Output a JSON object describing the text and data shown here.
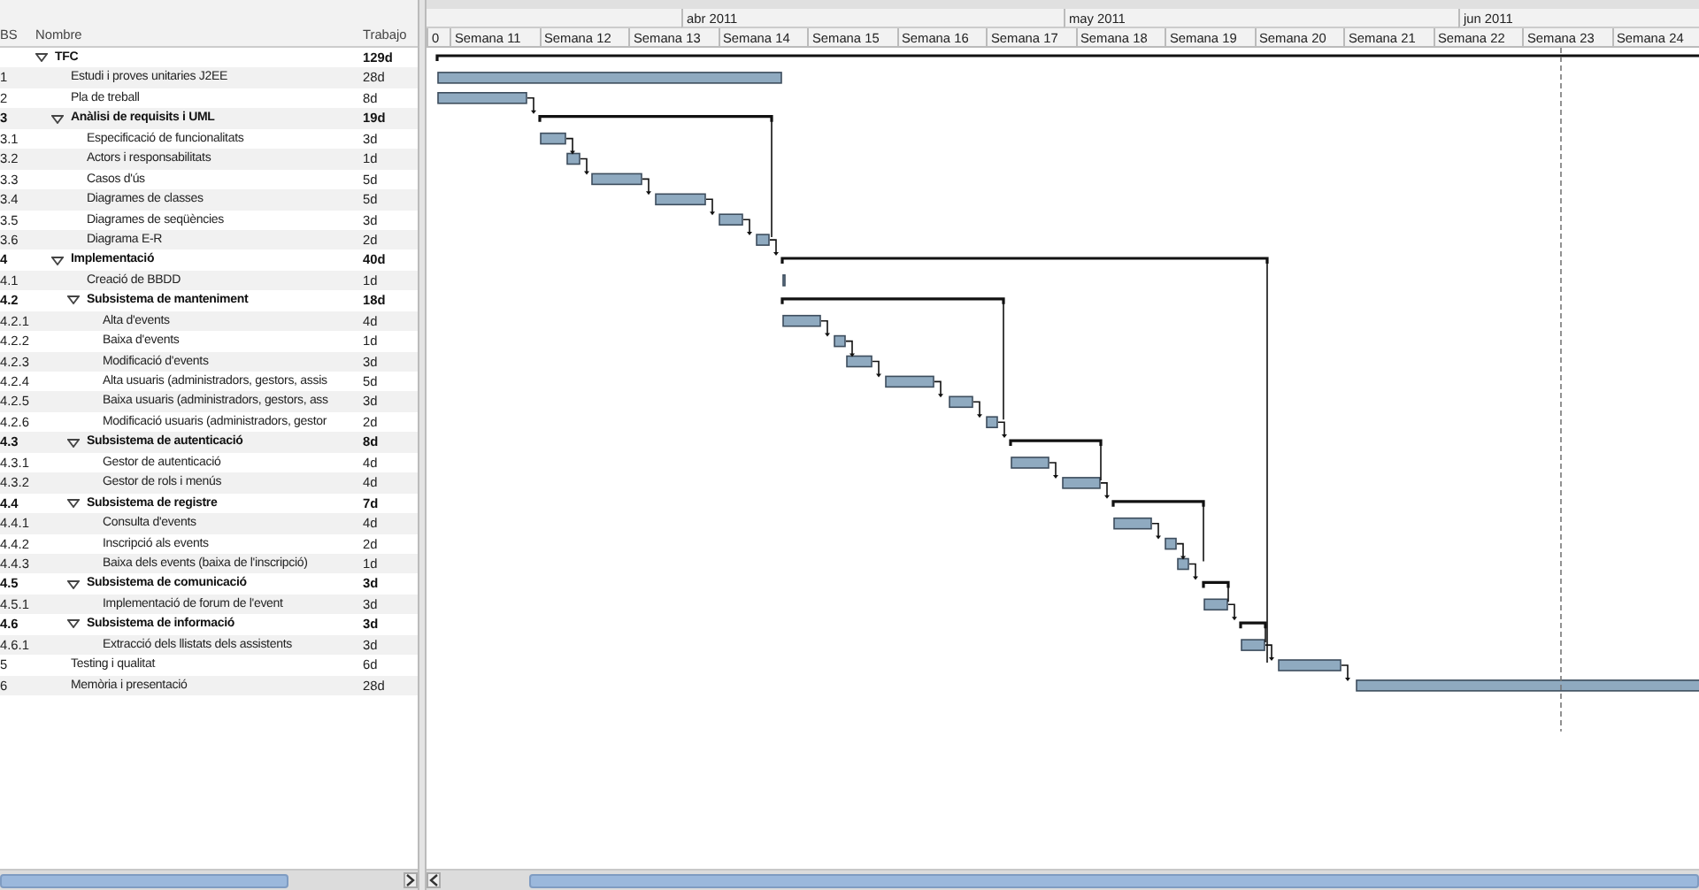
{
  "table": {
    "columns": [
      "BS",
      "Nombre",
      "Trabajo"
    ],
    "tasks": [
      {
        "name": "TFC",
        "work": "129d",
        "expanded": true,
        "children": [
          {
            "wbs": "1",
            "name": "Estudi i proves unitaries J2EE",
            "work": "28d"
          },
          {
            "wbs": "2",
            "name": "Pla de treball",
            "work": "8d"
          },
          {
            "wbs": "3",
            "name": "Anàlisi de requisits i UML",
            "work": "19d",
            "expanded": true,
            "children": [
              {
                "wbs": "3.1",
                "name": "Especificació de funcionalitats",
                "work": "3d"
              },
              {
                "wbs": "3.2",
                "name": "Actors i responsabilitats",
                "work": "1d"
              },
              {
                "wbs": "3.3",
                "name": "Casos d'ús",
                "work": "5d"
              },
              {
                "wbs": "3.4",
                "name": "Diagrames de classes",
                "work": "5d"
              },
              {
                "wbs": "3.5",
                "name": "Diagrames de seqüències",
                "work": "3d"
              },
              {
                "wbs": "3.6",
                "name": "Diagrama E-R",
                "work": "2d"
              }
            ]
          },
          {
            "wbs": "4",
            "name": "Implementació",
            "work": "40d",
            "expanded": true,
            "children": [
              {
                "wbs": "4.1",
                "name": "Creació de BBDD",
                "work": "1d"
              },
              {
                "wbs": "4.2",
                "name": "Subsistema de manteniment",
                "work": "18d",
                "expanded": true,
                "children": [
                  {
                    "wbs": "4.2.1",
                    "name": "Alta d'events",
                    "work": "4d"
                  },
                  {
                    "wbs": "4.2.2",
                    "name": "Baixa d'events",
                    "work": "1d"
                  },
                  {
                    "wbs": "4.2.3",
                    "name": "Modificació d'events",
                    "work": "3d"
                  },
                  {
                    "wbs": "4.2.4",
                    "name": "Alta usuaris (administradors, gestors, assis",
                    "work": "5d"
                  },
                  {
                    "wbs": "4.2.5",
                    "name": "Baixa usuaris (administradors, gestors, ass",
                    "work": "3d"
                  },
                  {
                    "wbs": "4.2.6",
                    "name": "Modificació usuaris (administradors, gestor",
                    "work": "2d"
                  }
                ]
              },
              {
                "wbs": "4.3",
                "name": "Subsistema de autenticació",
                "work": "8d",
                "expanded": true,
                "children": [
                  {
                    "wbs": "4.3.1",
                    "name": "Gestor de autenticació",
                    "work": "4d"
                  },
                  {
                    "wbs": "4.3.2",
                    "name": "Gestor de rols i menús",
                    "work": "4d"
                  }
                ]
              },
              {
                "wbs": "4.4",
                "name": "Subsistema de registre",
                "work": "7d",
                "expanded": true,
                "children": [
                  {
                    "wbs": "4.4.1",
                    "name": "Consulta d'events",
                    "work": "4d"
                  },
                  {
                    "wbs": "4.4.2",
                    "name": "Inscripció als events",
                    "work": "2d"
                  },
                  {
                    "wbs": "4.4.3",
                    "name": "Baixa dels events (baixa de l'inscripció)",
                    "work": "1d"
                  }
                ]
              },
              {
                "wbs": "4.5",
                "name": "Subsistema de comunicació",
                "work": "3d",
                "expanded": true,
                "children": [
                  {
                    "wbs": "4.5.1",
                    "name": "Implementació de forum de l'event",
                    "work": "3d"
                  }
                ]
              },
              {
                "wbs": "4.6",
                "name": "Subsistema de informació",
                "work": "3d",
                "expanded": true,
                "children": [
                  {
                    "wbs": "4.6.1",
                    "name": "Extracció dels llistats dels assistents",
                    "work": "3d"
                  }
                ]
              }
            ]
          },
          {
            "wbs": "5",
            "name": "Testing i qualitat",
            "work": "6d"
          },
          {
            "wbs": "6",
            "name": "Memòria i presentació",
            "work": "28d"
          }
        ]
      }
    ]
  },
  "timeline": {
    "months": [
      "abr 2011",
      "may 2011",
      "jun 2011"
    ],
    "weeks": [
      "0",
      "Semana 11",
      "Semana 12",
      "Semana 13",
      "Semana 14",
      "Semana 15",
      "Semana 16",
      "Semana 17",
      "Semana 18",
      "Semana 19",
      "Semana 20",
      "Semana 21",
      "Semana 22",
      "Semana 23",
      "Semana 24"
    ]
  }
}
